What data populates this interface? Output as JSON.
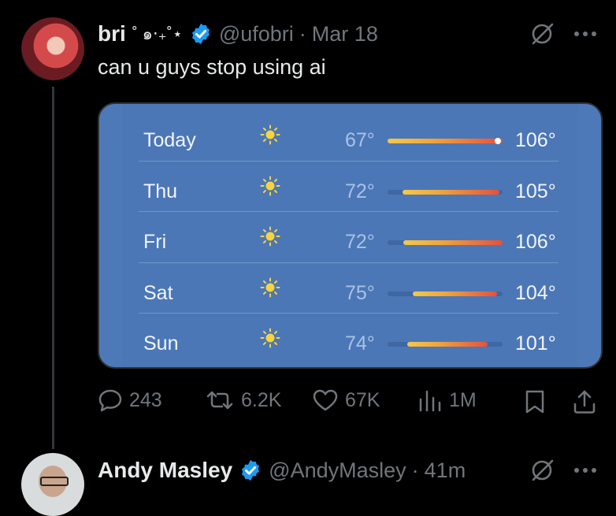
{
  "tweet": {
    "author_name": "bri",
    "name_decoration": "˚ ๑‧₊˚⋆",
    "handle": "@ufobri",
    "separator": "·",
    "time": "Mar 18",
    "text": "can u guys stop using ai",
    "forecast": [
      {
        "day": "Today",
        "low": "67°",
        "high": "106°",
        "range_start": 0.0,
        "range_end": 1.0,
        "current": true
      },
      {
        "day": "Thu",
        "low": "72°",
        "high": "105°",
        "range_start": 0.13,
        "range_end": 0.97,
        "current": false
      },
      {
        "day": "Fri",
        "low": "72°",
        "high": "106°",
        "range_start": 0.14,
        "range_end": 1.0,
        "current": false
      },
      {
        "day": "Sat",
        "low": "75°",
        "high": "104°",
        "range_start": 0.22,
        "range_end": 0.95,
        "current": false
      },
      {
        "day": "Sun",
        "low": "74°",
        "high": "101°",
        "range_start": 0.17,
        "range_end": 0.87,
        "current": false
      }
    ],
    "stats": {
      "replies": "243",
      "reposts": "6.2K",
      "likes": "67K",
      "views": "1M"
    }
  },
  "reply": {
    "author_name": "Andy Masley",
    "handle": "@AndyMasley",
    "separator": "·",
    "time": "41m"
  },
  "colors": {
    "background": "#000000",
    "text": "#e7e9ea",
    "muted": "#71767b",
    "verified": "#1d9bf0",
    "card_blue": "#4c77b6"
  }
}
